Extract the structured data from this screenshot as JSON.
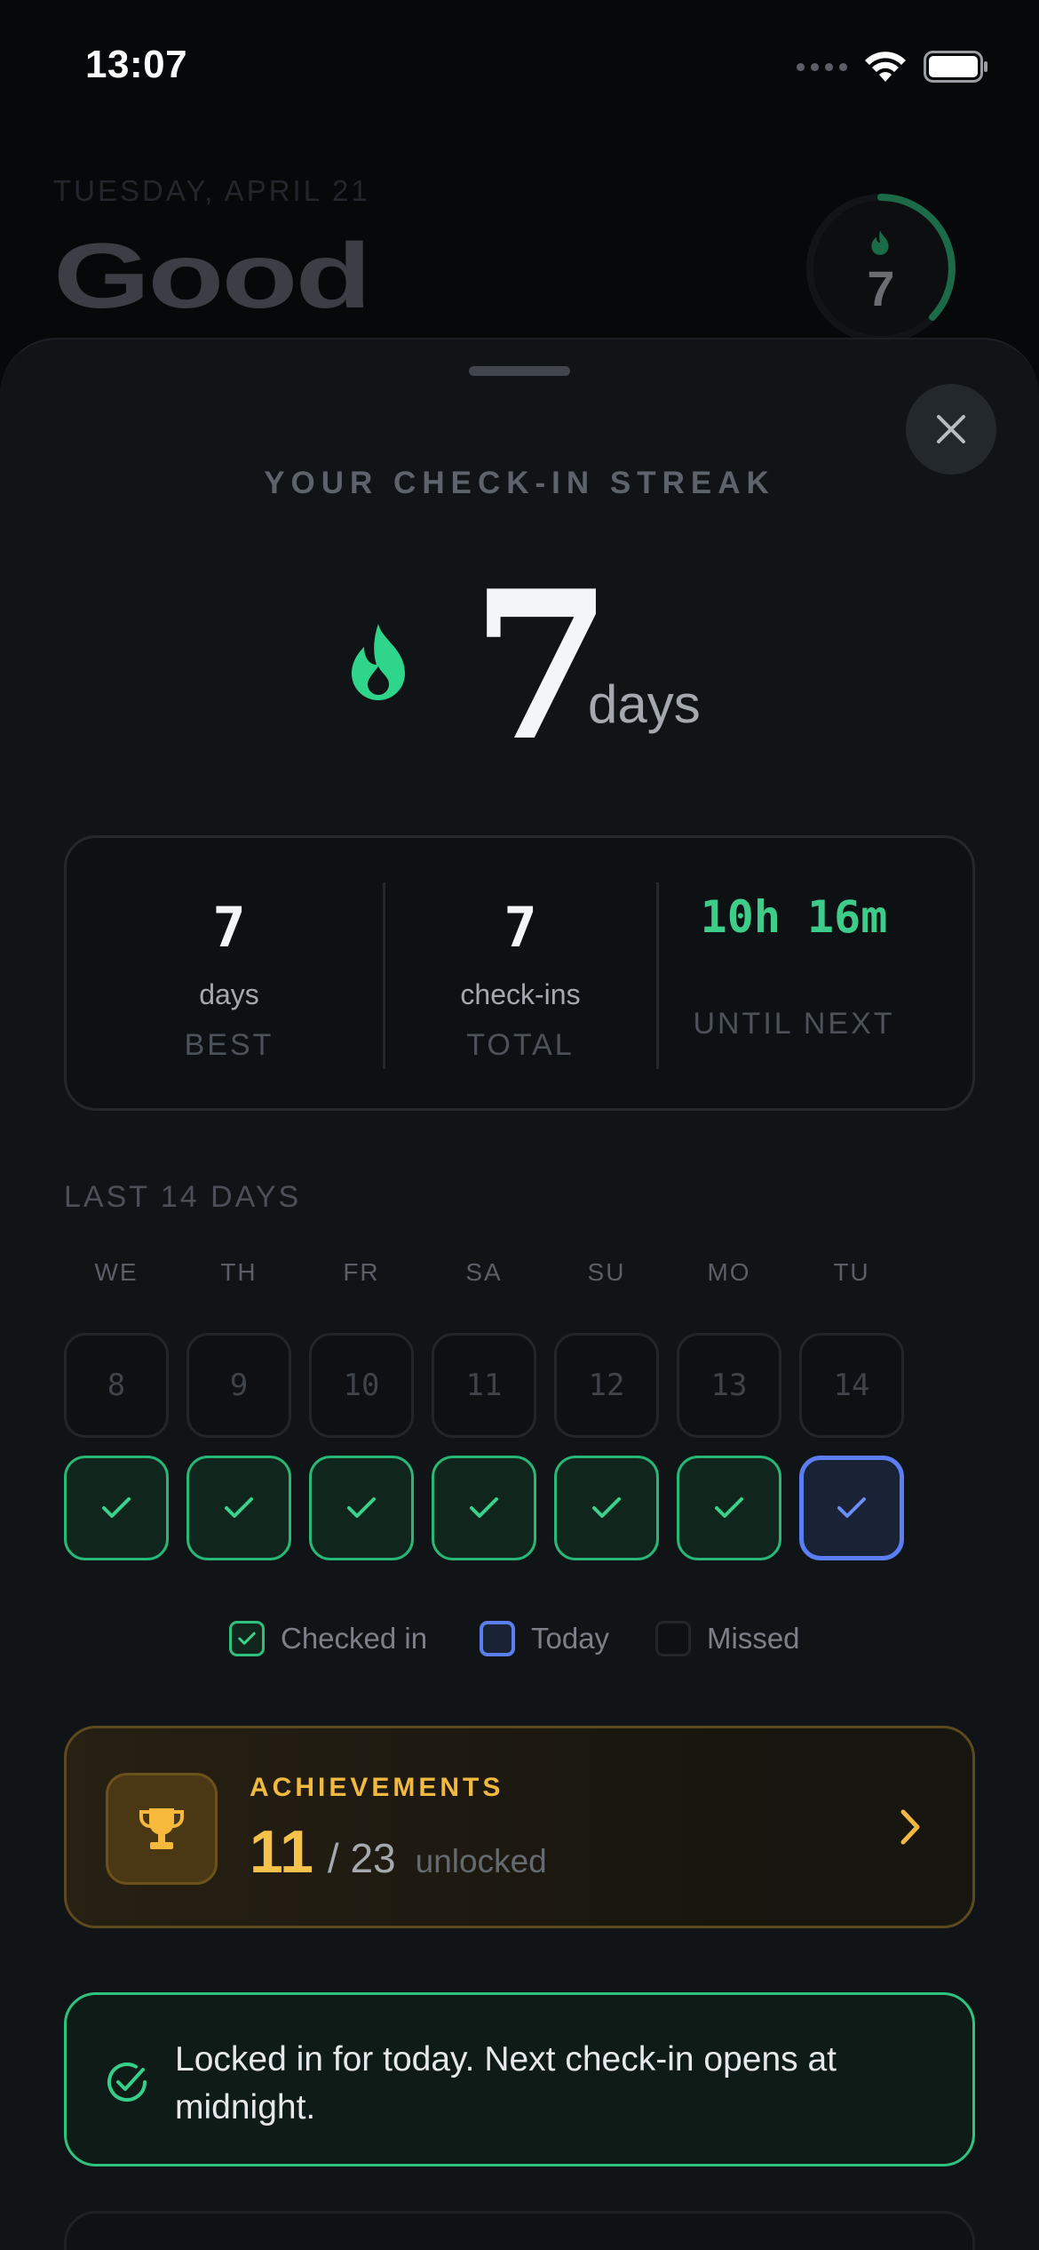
{
  "status_bar": {
    "time": "13:07"
  },
  "background": {
    "date": "TUESDAY, APRIL 21",
    "greeting": "Good",
    "ring_count": "7"
  },
  "sheet": {
    "title": "YOUR CHECK-IN STREAK",
    "streak_value": "7",
    "streak_unit": "days",
    "stats": [
      {
        "value": "7",
        "sub": "days",
        "label": "BEST"
      },
      {
        "value": "7",
        "sub": "check-ins",
        "label": "TOTAL"
      },
      {
        "value": "10h 16m",
        "label": "UNTIL NEXT"
      }
    ],
    "last14": {
      "heading": "LAST 14 DAYS",
      "weekdays": [
        "WE",
        "TH",
        "FR",
        "SA",
        "SU",
        "MO",
        "TU"
      ],
      "dates": [
        "8",
        "9",
        "10",
        "11",
        "12",
        "13",
        "14"
      ],
      "states": [
        "checked",
        "checked",
        "checked",
        "checked",
        "checked",
        "checked",
        "today"
      ]
    },
    "legend": {
      "checked": "Checked in",
      "today": "Today",
      "missed": "Missed"
    },
    "achievements": {
      "title": "ACHIEVEMENTS",
      "unlocked": "11",
      "total": "/ 23",
      "suffix": "unlocked"
    },
    "locked_message": "Locked in for today. Next check-in opens at midnight."
  },
  "colors": {
    "accent_green": "#3ecc8a",
    "today_blue": "#5b7ff2",
    "achievement_gold": "#f2b940"
  }
}
